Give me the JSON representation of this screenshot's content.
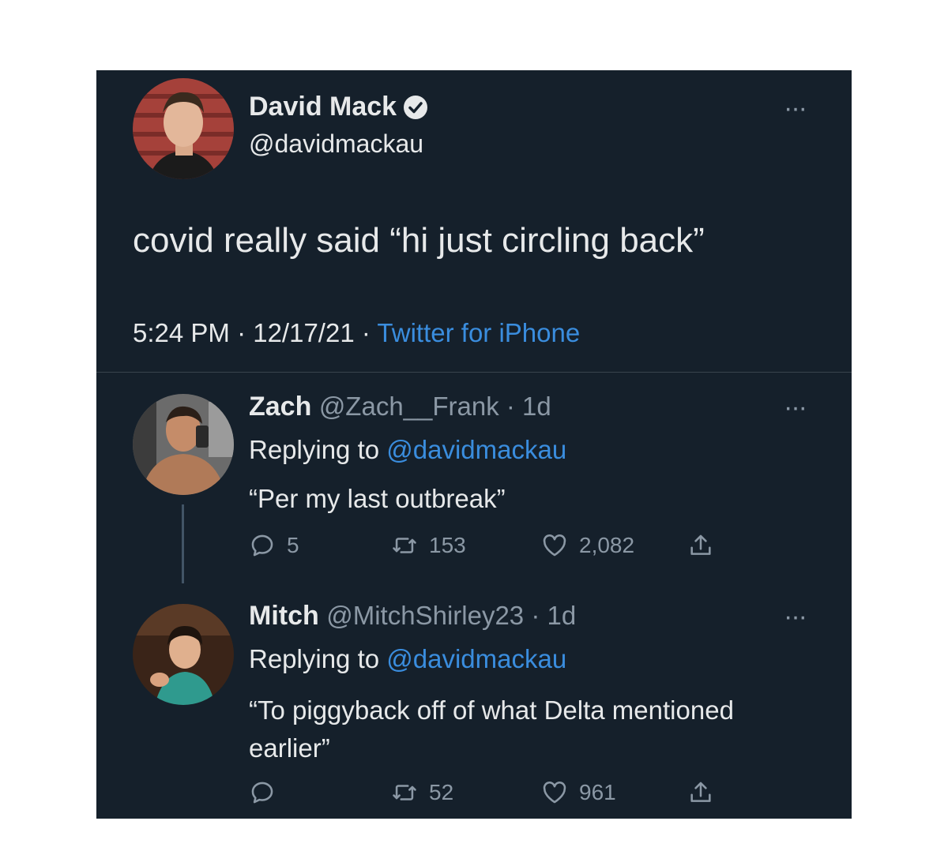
{
  "main_tweet": {
    "author_name": "David Mack",
    "author_handle": "@davidmackau",
    "text": "covid really said “hi just circling back”",
    "time": "5:24 PM · 12/17/21 · ",
    "source": "Twitter for iPhone"
  },
  "replies": [
    {
      "name": "Zach",
      "handle_time": "@Zach__Frank · 1d",
      "replying_prefix": "Replying to ",
      "replying_handle": "@davidmackau",
      "text": "“Per my last outbreak”",
      "reply_count": "5",
      "retweet_count": "153",
      "like_count": "2,082"
    },
    {
      "name": "Mitch",
      "handle_time": "@MitchShirley23 · 1d",
      "replying_prefix": "Replying to ",
      "replying_handle": "@davidmackau",
      "text": "“To piggyback off of what Delta mentioned earlier”",
      "reply_count": "",
      "retweet_count": "52",
      "like_count": "961"
    }
  ],
  "more_glyph": "···",
  "colors": {
    "background": "#15202b",
    "primary_text": "#e7e9ea",
    "secondary_text": "#8b98a5",
    "accent": "#1d9bf0"
  },
  "icons": [
    "verified-badge-icon",
    "more-icon",
    "reply-icon",
    "retweet-icon",
    "like-icon",
    "share-icon"
  ]
}
